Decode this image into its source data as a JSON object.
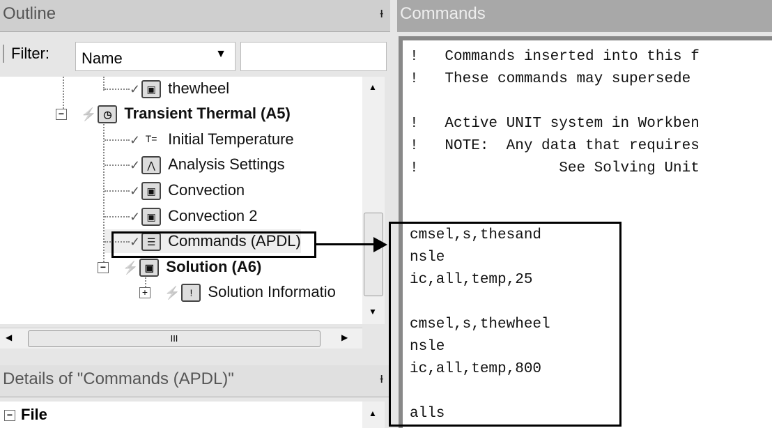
{
  "outline": {
    "title": "Outline",
    "pin_icon": "pin-icon",
    "filter_label": "Filter:",
    "filter_value": "Name",
    "search_value": ""
  },
  "tree": [
    {
      "label": "thewheel",
      "icon": "body-icon",
      "bold": false
    },
    {
      "label": "Transient Thermal (A5)",
      "icon": "transient-thermal-icon",
      "bold": true
    },
    {
      "label": "Initial Temperature",
      "icon": "initial-temperature-icon",
      "bold": false
    },
    {
      "label": "Analysis Settings",
      "icon": "analysis-settings-icon",
      "bold": false
    },
    {
      "label": "Convection",
      "icon": "convection-icon",
      "bold": false
    },
    {
      "label": "Convection 2",
      "icon": "convection-icon",
      "bold": false
    },
    {
      "label": "Commands (APDL)",
      "icon": "commands-icon",
      "bold": false
    },
    {
      "label": "Solution (A6)",
      "icon": "solution-icon",
      "bold": true
    },
    {
      "label": "Solution Informatio",
      "icon": "solution-information-icon",
      "bold": false
    }
  ],
  "hscroll": {
    "thumb_label": "III"
  },
  "details": {
    "title": "Details of \"Commands (APDL)\"",
    "section": "File"
  },
  "commands": {
    "title": "Commands",
    "lines": [
      "!   Commands inserted into this f",
      "!   These commands may supersede ",
      "",
      "!   Active UNIT system in Workben",
      "!   NOTE:  Any data that requires",
      "!                See Solving Unit",
      "",
      "",
      "cmsel,s,thesand",
      "nsle",
      "ic,all,temp,25",
      "",
      "cmsel,s,thewheel",
      "nsle",
      "ic,all,temp,800",
      "",
      "alls"
    ]
  }
}
